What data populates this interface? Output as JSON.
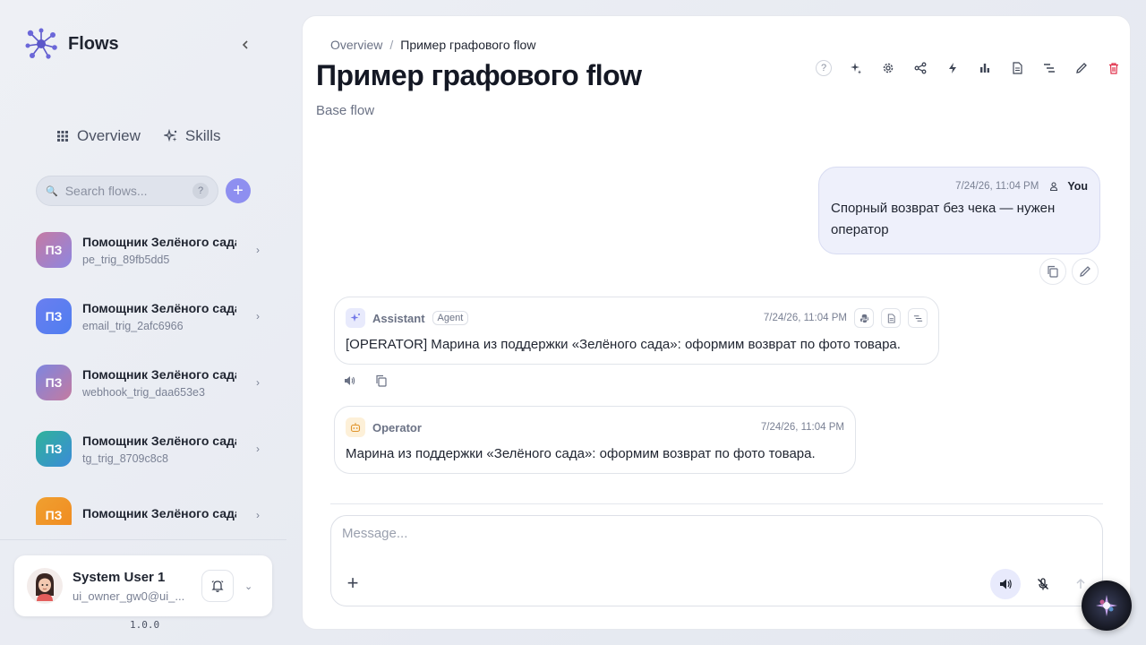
{
  "app": {
    "name": "Flows",
    "version": "1.0.0"
  },
  "nav": [
    {
      "label": "Overview",
      "icon": "grid-icon"
    },
    {
      "label": "Skills",
      "icon": "sparkles-icon"
    }
  ],
  "search": {
    "placeholder": "Search flows...",
    "help": "?"
  },
  "flows": [
    {
      "initials": "ПЗ",
      "title": "Помощник Зелёного сада",
      "sub": "pe_trig_89fb5dd5",
      "color": "linear-gradient(135deg,#c57aa3,#8e86e0)"
    },
    {
      "initials": "ПЗ",
      "title": "Помощник Зелёного сада",
      "sub": "email_trig_2afc6966",
      "color": "linear-gradient(135deg,#6a7ff0,#4f7df0)"
    },
    {
      "initials": "ПЗ",
      "title": "Помощник Зелёного сада",
      "sub": "webhook_trig_daa653e3",
      "color": "linear-gradient(135deg,#7d86e0,#c47aa0)"
    },
    {
      "initials": "ПЗ",
      "title": "Помощник Зелёного сада",
      "sub": "tg_trig_8709c8c8",
      "color": "linear-gradient(135deg,#2fb39a,#3b8bd8)"
    },
    {
      "initials": "ПЗ",
      "title": "Помощник Зелёного сада",
      "sub": "",
      "color": "linear-gradient(135deg,#f0a030,#f08a20)"
    }
  ],
  "user": {
    "name": "System User 1",
    "email": "ui_owner_gw0@ui_..."
  },
  "breadcrumb": {
    "root": "Overview",
    "sep": "/",
    "current": "Пример графового flow"
  },
  "page": {
    "title": "Пример графового flow",
    "subtitle": "Base flow"
  },
  "toolbar": [
    "help-icon",
    "sparkle-icon",
    "gear-icon",
    "share-icon",
    "bolt-icon",
    "bar-chart-icon",
    "document-icon",
    "list-icon",
    "pencil-icon",
    "trash-icon"
  ],
  "messages": {
    "user": {
      "time": "7/24/26, 11:04 PM",
      "who": "You",
      "text": "Спорный возврат без чека — нужен оператор"
    },
    "assistant": {
      "name": "Assistant",
      "badge": "Agent",
      "time": "7/24/26, 11:04 PM",
      "text": "[OPERATOR] Марина из поддержки «Зелёного сада»: оформим возврат по фото товара."
    },
    "operator": {
      "name": "Operator",
      "time": "7/24/26, 11:04 PM",
      "text": "Марина из поддержки «Зелёного сада»: оформим возврат по фото товара."
    }
  },
  "composer": {
    "placeholder": "Message..."
  },
  "colors": {
    "accent": "#8e8ff0",
    "danger": "#e0314b"
  }
}
